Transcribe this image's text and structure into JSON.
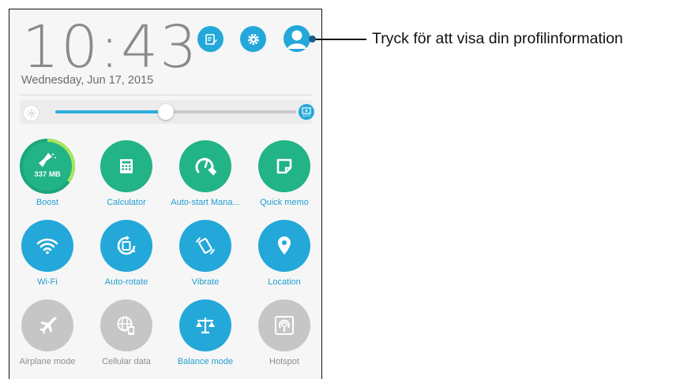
{
  "status": {
    "time_hours": "10",
    "time_minutes": "43",
    "date": "Wednesday, Jun 17, 2015"
  },
  "header_icons": [
    "edit-icon",
    "settings-gear-icon",
    "profile-avatar-icon"
  ],
  "brightness": {
    "level": 0.46,
    "auto_label": "AUTO"
  },
  "tiles": [
    {
      "label": "Boost",
      "value": "337 MB",
      "icon": "boost-broom-icon",
      "color": "green",
      "ring_fraction": 0.35
    },
    {
      "label": "Calculator",
      "icon": "calculator-icon",
      "color": "green"
    },
    {
      "label": "Auto-start Mana...",
      "icon": "auto-start-manager-icon",
      "color": "green"
    },
    {
      "label": "Quick memo",
      "icon": "quick-memo-icon",
      "color": "green"
    },
    {
      "label": "Wi-Fi",
      "icon": "wifi-icon",
      "color": "blue"
    },
    {
      "label": "Auto-rotate",
      "icon": "auto-rotate-icon",
      "color": "blue"
    },
    {
      "label": "Vibrate",
      "icon": "vibrate-icon",
      "color": "blue"
    },
    {
      "label": "Location",
      "icon": "location-pin-icon",
      "color": "blue"
    },
    {
      "label": "Airplane mode",
      "icon": "airplane-icon",
      "color": "grey"
    },
    {
      "label": "Cellular data",
      "icon": "cellular-data-icon",
      "color": "grey"
    },
    {
      "label": "Balance mode",
      "icon": "balance-scale-icon",
      "color": "blue"
    },
    {
      "label": "Hotspot",
      "icon": "hotspot-icon",
      "color": "grey"
    }
  ],
  "callout": {
    "text": "Tryck för att visa din profilinformation"
  }
}
